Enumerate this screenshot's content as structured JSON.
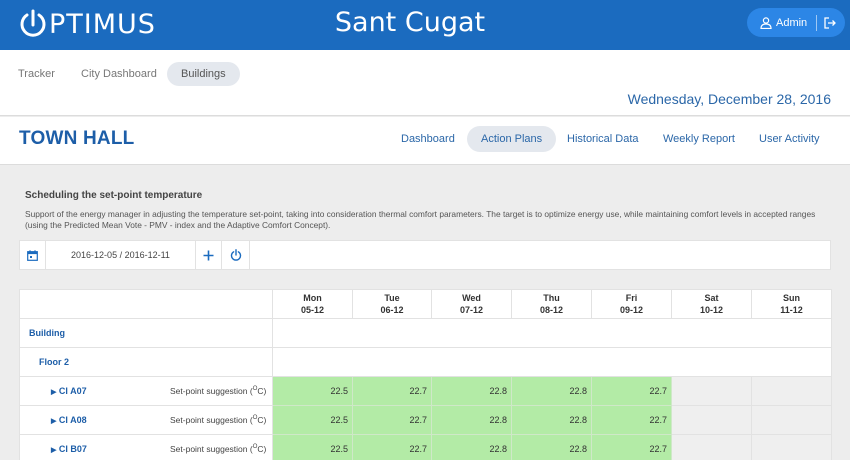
{
  "header": {
    "logo_text": "PTIMUS",
    "city": "Sant Cugat",
    "user_label": "Admin",
    "icons": {
      "logo": "power-icon",
      "user": "user-icon",
      "logout": "logout-icon"
    }
  },
  "subnav": {
    "items": [
      {
        "label": "Tracker",
        "active": false
      },
      {
        "label": "City Dashboard",
        "active": false
      },
      {
        "label": "Buildings",
        "active": true
      }
    ],
    "date": "Wednesday, December 28, 2016"
  },
  "building": {
    "title": "TOWN HALL",
    "tabs": [
      {
        "label": "Dashboard",
        "active": false
      },
      {
        "label": "Action Plans",
        "active": true
      },
      {
        "label": "Historical Data",
        "active": false
      },
      {
        "label": "Weekly Report",
        "active": false
      },
      {
        "label": "User Activity",
        "active": false
      }
    ]
  },
  "section": {
    "title": "Scheduling the set-point temperature",
    "description": "Support of the energy manager in adjusting the temperature set-point, taking into consideration thermal comfort parameters. The target is to optimize energy use, while maintaining comfort levels in accepted ranges (using the Predicted Mean Vote - PMV - index and the Adaptive Comfort Concept)."
  },
  "toolbar": {
    "date_range": "2016-12-05 / 2016-12-11",
    "icons": {
      "calendar": "calendar-icon",
      "add": "plus-icon",
      "power": "power-icon"
    }
  },
  "table": {
    "days": [
      {
        "name": "Mon",
        "date": "05-12"
      },
      {
        "name": "Tue",
        "date": "06-12"
      },
      {
        "name": "Wed",
        "date": "07-12"
      },
      {
        "name": "Thu",
        "date": "08-12"
      },
      {
        "name": "Fri",
        "date": "09-12"
      },
      {
        "name": "Sat",
        "date": "10-12"
      },
      {
        "name": "Sun",
        "date": "11-12"
      }
    ],
    "building_label": "Building",
    "floor_label": "Floor 2",
    "suggestion_label": "Set-point suggestion (",
    "suggestion_unit": "O",
    "suggestion_suffix": "C)",
    "rooms": [
      {
        "name": "CI A07",
        "values": [
          "22.5",
          "22.7",
          "22.8",
          "22.8",
          "22.7"
        ]
      },
      {
        "name": "CI A08",
        "values": [
          "22.5",
          "22.7",
          "22.8",
          "22.8",
          "22.7"
        ]
      },
      {
        "name": "CI B07",
        "values": [
          "22.5",
          "22.7",
          "22.8",
          "22.8",
          "22.7"
        ]
      }
    ],
    "colors": {
      "suggestion_fill": "#b3eba6",
      "weekend_fill": "#efefef",
      "accent": "#1b6bbf"
    }
  }
}
